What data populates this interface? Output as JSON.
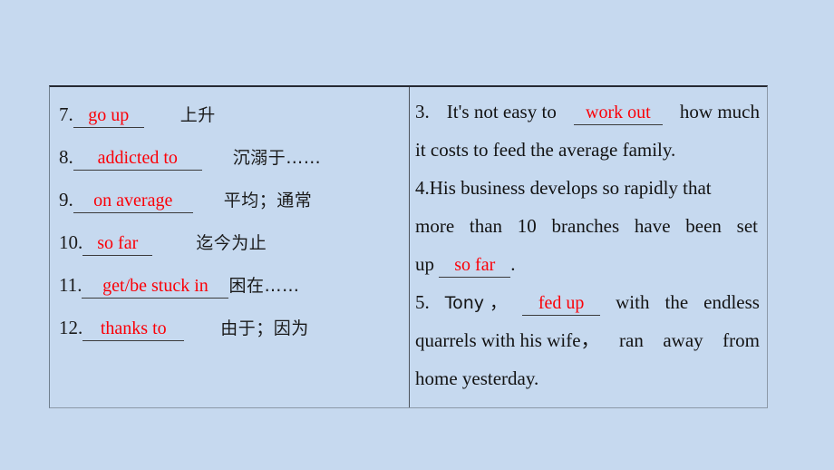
{
  "slide": {
    "background_color": "#c6d9ef",
    "answer_color": "#fb0007",
    "text_color": "#131313"
  },
  "left_column": {
    "rows": [
      {
        "number": "7.",
        "answer": "go up",
        "meaning": "上升"
      },
      {
        "number": "8.",
        "answer": "addicted to",
        "meaning": "沉溺于……"
      },
      {
        "number": "9.",
        "answer": "on average",
        "meaning": "平均；通常"
      },
      {
        "number": "10.",
        "answer": "so far",
        "meaning": "迄今为止"
      },
      {
        "number": "11.",
        "answer": "get/be stuck in",
        "meaning": "困在……"
      },
      {
        "number": "12.",
        "answer": "thanks to",
        "meaning": "由于；因为"
      }
    ]
  },
  "right_column": {
    "items": [
      {
        "number": "3.",
        "answer": "work out",
        "line1_before": "It's not easy to",
        "line1_after": "how much",
        "line2": "it costs to feed the average family."
      },
      {
        "number": "4.",
        "answer": "so far",
        "line1": "His business develops so rapidly that",
        "line2_words": [
          "more",
          "than",
          "10",
          "branches",
          "have",
          "been",
          "set"
        ],
        "line3_before": "up",
        "line3_after": "."
      },
      {
        "number": "5.",
        "answer": "fed up",
        "line1_before": "Tony ，",
        "line1_words": [
          "with",
          "the",
          "endless"
        ],
        "line2_words": [
          "quarrels with his wife，",
          "ran",
          "away",
          "from"
        ],
        "line3": "home yesterday."
      }
    ]
  }
}
